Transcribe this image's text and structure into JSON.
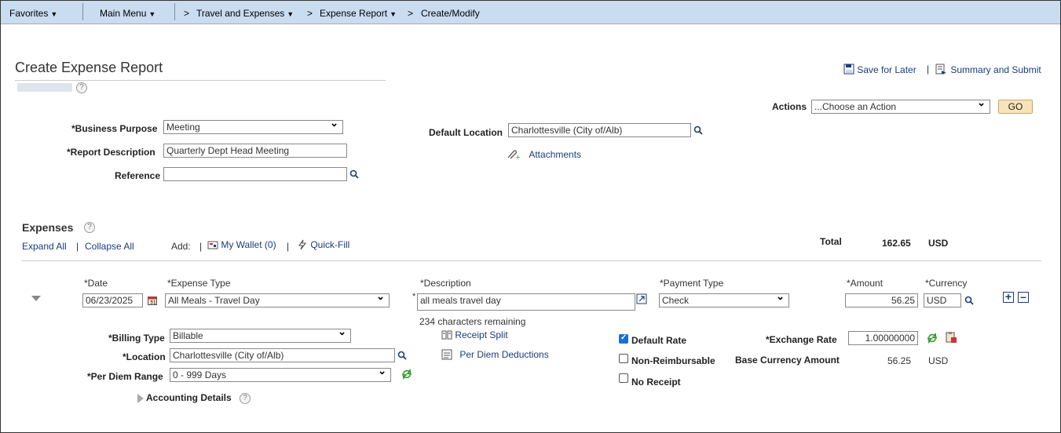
{
  "nav": {
    "favorites": "Favorites",
    "main_menu": "Main Menu",
    "crumb_sep": ">",
    "travel": "Travel and Expenses",
    "expense_report": "Expense Report",
    "create_modify": "Create/Modify"
  },
  "header": {
    "title": "Create Expense Report",
    "save_for_later": "Save for Later",
    "divider": "|",
    "summary_submit": "Summary and Submit"
  },
  "actions": {
    "label": "Actions",
    "value": "...Choose an Action",
    "go": "GO"
  },
  "form": {
    "business_purpose_label": "*Business Purpose",
    "business_purpose_value": "Meeting",
    "report_description_label": "*Report Description",
    "report_description_value": "Quarterly Dept Head Meeting",
    "reference_label": "Reference",
    "reference_value": "",
    "default_location_label": "Default Location",
    "default_location_value": "Charlottesville (City of/Alb)",
    "attachments": "Attachments"
  },
  "expenses": {
    "title": "Expenses",
    "expand_all": "Expand All",
    "collapse_all": "Collapse All",
    "add_label": "Add:",
    "my_wallet": "My Wallet (0)",
    "quick_fill": "Quick-Fill",
    "total_label": "Total",
    "total_value": "162.65",
    "total_currency": "USD"
  },
  "line": {
    "date_label": "*Date",
    "date_value": "06/23/2025",
    "expense_type_label": "*Expense Type",
    "expense_type_value": "All Meals - Travel Day",
    "description_label": "*Description",
    "description_value": "all meals travel day",
    "chars_remaining": "234 characters remaining",
    "payment_type_label": "*Payment Type",
    "payment_type_value": "Check",
    "amount_label": "*Amount",
    "amount_value": "56.25",
    "currency_label": "*Currency",
    "currency_value": "USD",
    "billing_type_label": "*Billing Type",
    "billing_type_value": "Billable",
    "location_label": "*Location",
    "location_value": "Charlottesville (City of/Alb)",
    "per_diem_range_label": "*Per Diem Range",
    "per_diem_range_value": "0 - 999  Days",
    "receipt_split": "Receipt Split",
    "per_diem_deductions": "Per Diem Deductions",
    "default_rate": "Default Rate",
    "default_rate_checked": true,
    "non_reimbursable": "Non-Reimbursable",
    "no_receipt": "No Receipt",
    "exchange_rate_label": "*Exchange Rate",
    "exchange_rate_value": "1.00000000",
    "base_currency_label": "Base Currency Amount",
    "base_currency_value": "56.25",
    "base_currency_code": "USD",
    "accounting_details": "Accounting Details"
  },
  "colors": {
    "nav_bg": "#c9dcf0",
    "link": "#1a3d7c",
    "checkbox_on": "#1a6fd6",
    "go_button": "#f7e4b8",
    "refresh_green": "#2e9a2e"
  }
}
